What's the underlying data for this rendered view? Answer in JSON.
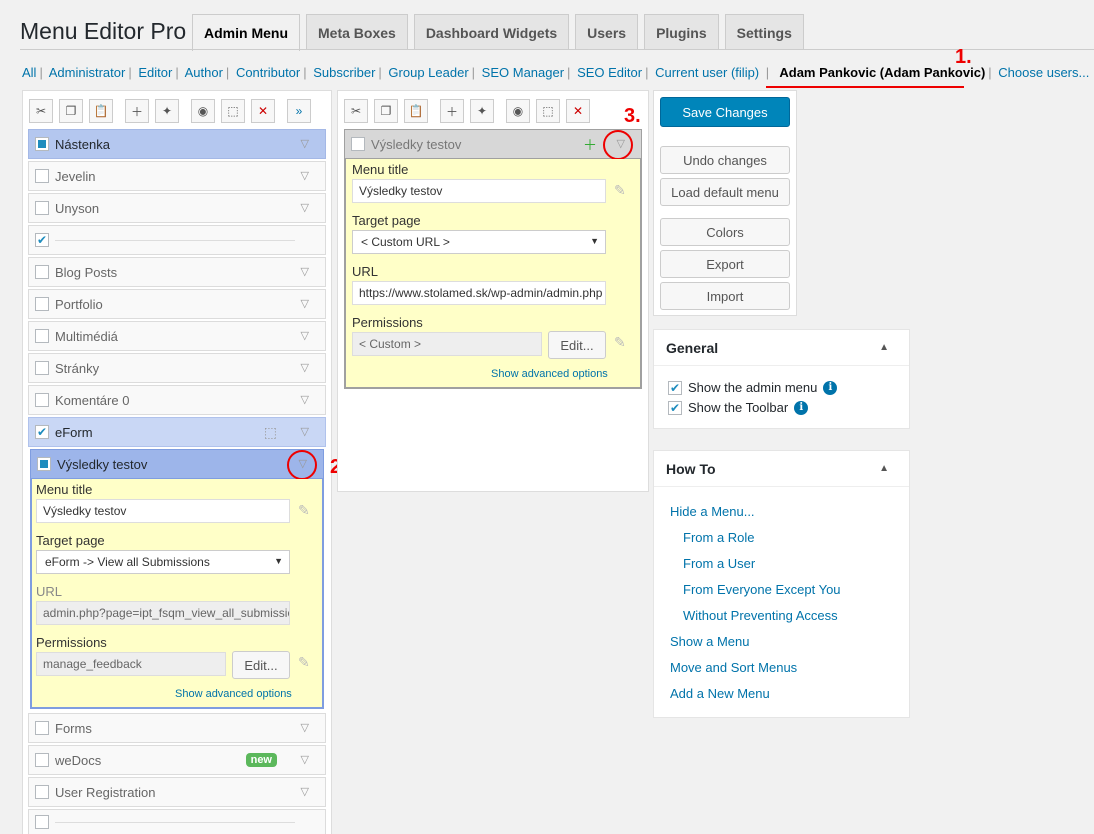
{
  "app_title": "Menu Editor Pro",
  "tabs": [
    "Admin Menu",
    "Meta Boxes",
    "Dashboard Widgets",
    "Users",
    "Plugins",
    "Settings"
  ],
  "roles": [
    "All",
    "Administrator",
    "Editor",
    "Author",
    "Contributor",
    "Subscriber",
    "Group Leader",
    "SEO Manager",
    "SEO Editor",
    "Current user (filip)"
  ],
  "current_actor": "Adam Pankovic (Adam Pankovic)",
  "choose_users": "Choose users...",
  "annotations": {
    "one": "1.",
    "two": "2.",
    "three": "3."
  },
  "menu_items": [
    {
      "label": "Nástenka",
      "state": "selected"
    },
    {
      "label": "Jevelin"
    },
    {
      "label": "Unyson"
    },
    {
      "label": "",
      "separator": true
    },
    {
      "label": "Blog Posts"
    },
    {
      "label": "Portfolio"
    },
    {
      "label": "Multimédiá"
    },
    {
      "label": "Stránky"
    },
    {
      "label": "Komentáre 0"
    },
    {
      "label": "eForm",
      "state": "checked"
    },
    {
      "label": "Výsledky testov",
      "state": "open"
    }
  ],
  "menu_items_below": [
    {
      "label": "Forms"
    },
    {
      "label": "weDocs",
      "badge": "new"
    },
    {
      "label": "User Registration"
    }
  ],
  "left_editor": {
    "menu_title_label": "Menu title",
    "menu_title": "Výsledky testov",
    "target_label": "Target page",
    "target": "eForm -> View all Submissions",
    "url_label": "URL",
    "url": "admin.php?page=ipt_fsqm_view_all_submissions",
    "perm_label": "Permissions",
    "perm": "manage_feedback",
    "edit": "Edit...",
    "advanced": "Show advanced options"
  },
  "sub_item": {
    "label": "Výsledky testov"
  },
  "sub_editor": {
    "menu_title_label": "Menu title",
    "menu_title": "Výsledky testov",
    "target_label": "Target page",
    "target": "< Custom URL >",
    "url_label": "URL",
    "url": "https://www.stolamed.sk/wp-admin/admin.php",
    "perm_label": "Permissions",
    "perm": "< Custom >",
    "edit": "Edit...",
    "advanced": "Show advanced options"
  },
  "actions": {
    "save": "Save Changes",
    "undo": "Undo changes",
    "load_default": "Load default menu",
    "colors": "Colors",
    "export": "Export",
    "import": "Import"
  },
  "general": {
    "title": "General",
    "show_admin_menu": "Show the admin menu",
    "show_toolbar": "Show the Toolbar"
  },
  "howto": {
    "title": "How To",
    "links": [
      "Hide a Menu...",
      "From a Role",
      "From a User",
      "From Everyone Except You",
      "Without Preventing Access",
      "Show a Menu",
      "Move and Sort Menus",
      "Add a New Menu"
    ]
  }
}
